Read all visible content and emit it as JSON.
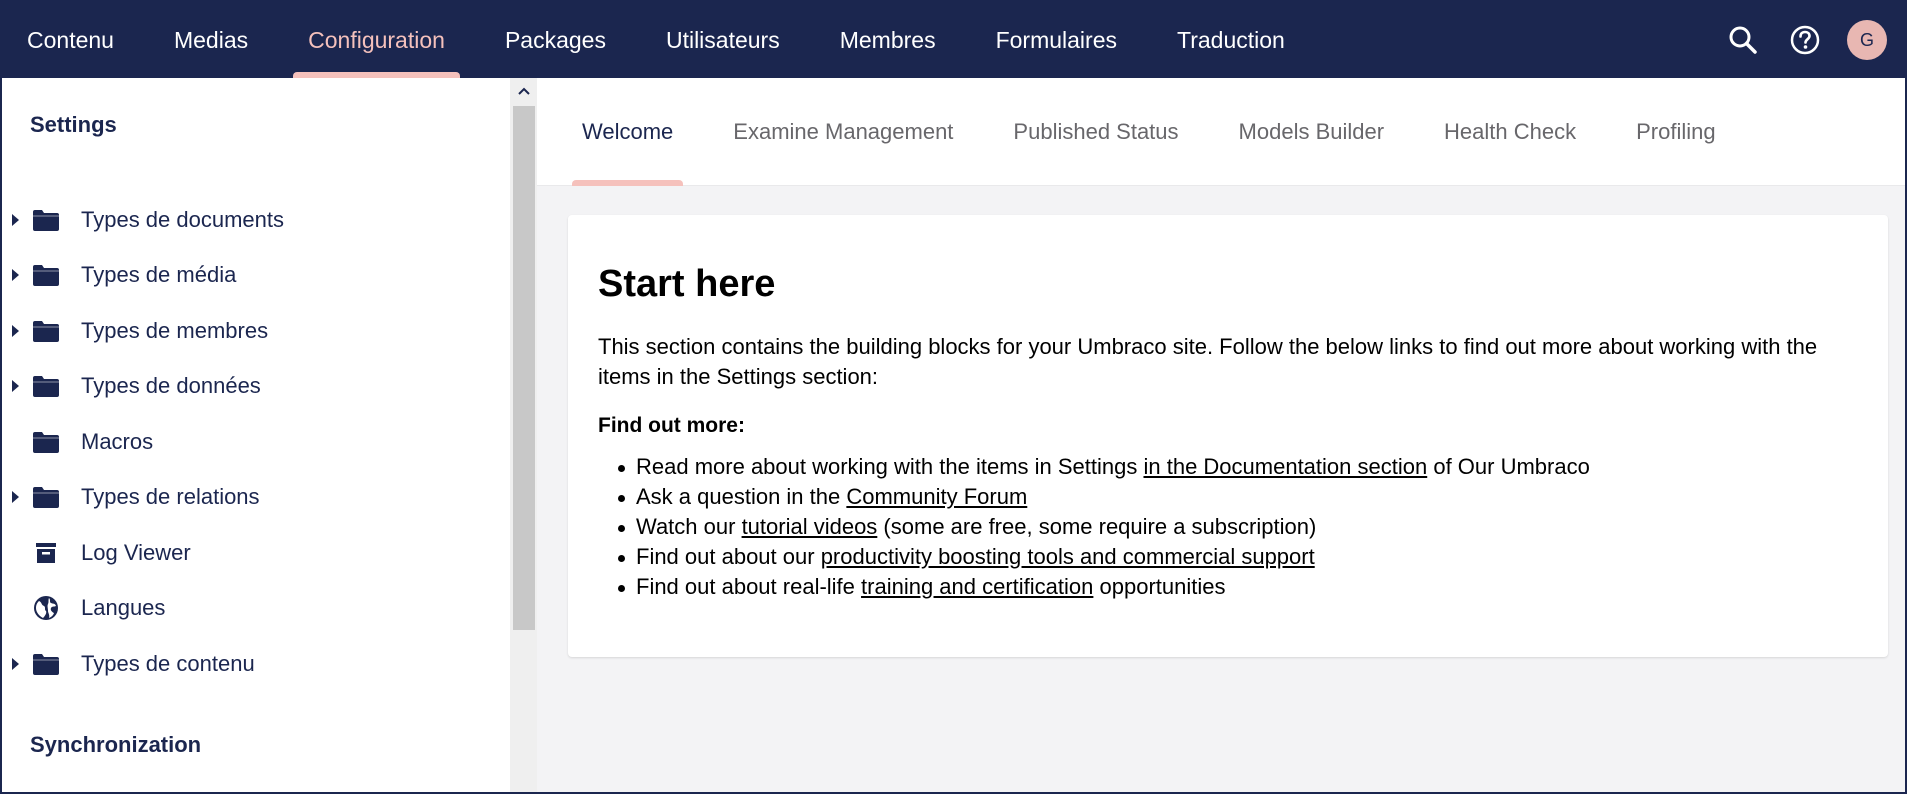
{
  "header": {
    "sections": [
      {
        "label": "Contenu",
        "active": false
      },
      {
        "label": "Medias",
        "active": false
      },
      {
        "label": "Configuration",
        "active": true
      },
      {
        "label": "Packages",
        "active": false
      },
      {
        "label": "Utilisateurs",
        "active": false
      },
      {
        "label": "Membres",
        "active": false
      },
      {
        "label": "Formulaires",
        "active": false
      },
      {
        "label": "Traduction",
        "active": false
      }
    ],
    "tools": {
      "search_icon": "search-icon",
      "help_icon": "help-icon",
      "avatar_initial": "G"
    }
  },
  "sidebar": {
    "settings_heading": "Settings",
    "items": [
      {
        "label": "Types de documents",
        "icon": "folder-icon",
        "expandable": true
      },
      {
        "label": "Types de média",
        "icon": "folder-icon",
        "expandable": true
      },
      {
        "label": "Types de membres",
        "icon": "folder-icon",
        "expandable": true
      },
      {
        "label": "Types de données",
        "icon": "folder-icon",
        "expandable": true
      },
      {
        "label": "Macros",
        "icon": "folder-icon",
        "expandable": false
      },
      {
        "label": "Types de relations",
        "icon": "folder-icon",
        "expandable": true
      },
      {
        "label": "Log Viewer",
        "icon": "archive-icon",
        "expandable": false
      },
      {
        "label": "Langues",
        "icon": "globe-icon",
        "expandable": false
      },
      {
        "label": "Types de contenu",
        "icon": "folder-icon",
        "expandable": true
      }
    ],
    "sync_heading": "Synchronization"
  },
  "tabs": [
    {
      "label": "Welcome",
      "active": true
    },
    {
      "label": "Examine Management",
      "active": false
    },
    {
      "label": "Published Status",
      "active": false
    },
    {
      "label": "Models Builder",
      "active": false
    },
    {
      "label": "Health Check",
      "active": false
    },
    {
      "label": "Profiling",
      "active": false
    }
  ],
  "content": {
    "title": "Start here",
    "intro": "This section contains the building blocks for your Umbraco site. Follow the below links to find out more about working with the items in the Settings section:",
    "find_more": "Find out more:",
    "links": [
      {
        "before": "Read more about working with the items in Settings ",
        "link": "in the Documentation section",
        "after": " of Our Umbraco"
      },
      {
        "before": "Ask a question in the ",
        "link": "Community Forum",
        "after": ""
      },
      {
        "before": "Watch our ",
        "link": "tutorial videos",
        "after": " (some are free, some require a subscription)"
      },
      {
        "before": "Find out about our ",
        "link": "productivity boosting tools and commercial support",
        "after": ""
      },
      {
        "before": "Find out about real-life ",
        "link": "training and certification",
        "after": " opportunities"
      }
    ]
  },
  "colors": {
    "navy": "#1b264f",
    "accent": "#f5c1bc",
    "avatar_bg": "#e8b7b2",
    "main_bg": "#f3f3f5"
  }
}
